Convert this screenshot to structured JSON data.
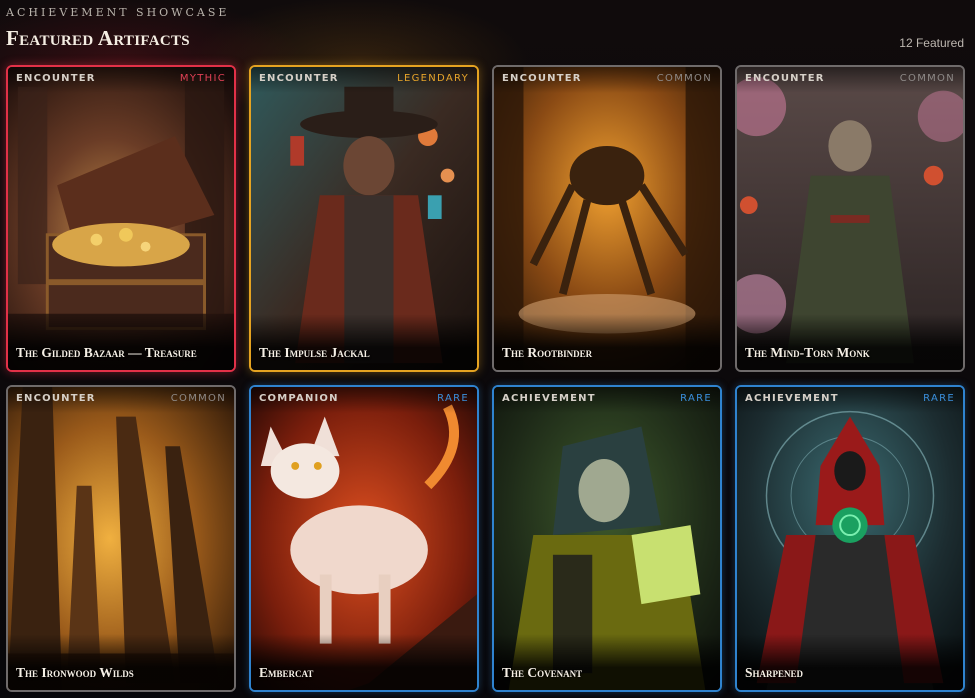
{
  "header": {
    "eyebrow": "Achievement Showcase",
    "title": "Featured Artifacts",
    "count_label": "12 Featured"
  },
  "cards": [
    {
      "type": "Encounter",
      "rarity": "Mythic",
      "name": "The Gilded Bazaar — Treasure",
      "rarity_color": "#e04055"
    },
    {
      "type": "Encounter",
      "rarity": "Legendary",
      "name": "The Impulse Jackal",
      "rarity_color": "#e6a42a"
    },
    {
      "type": "Encounter",
      "rarity": "Common",
      "name": "The Rootbinder",
      "rarity_color": "#8e8a88"
    },
    {
      "type": "Encounter",
      "rarity": "Common",
      "name": "The Mind-Torn Monk",
      "rarity_color": "#8e8a88"
    },
    {
      "type": "Encounter",
      "rarity": "Common",
      "name": "The Ironwood Wilds",
      "rarity_color": "#8e8a88"
    },
    {
      "type": "Companion",
      "rarity": "Rare",
      "name": "Embercat",
      "rarity_color": "#3a8fdc"
    },
    {
      "type": "Achievement",
      "rarity": "Rare",
      "name": "The Covenant",
      "rarity_color": "#3a8fdc"
    },
    {
      "type": "Achievement",
      "rarity": "Rare",
      "name": "Sharpened",
      "rarity_color": "#3a8fdc"
    }
  ]
}
